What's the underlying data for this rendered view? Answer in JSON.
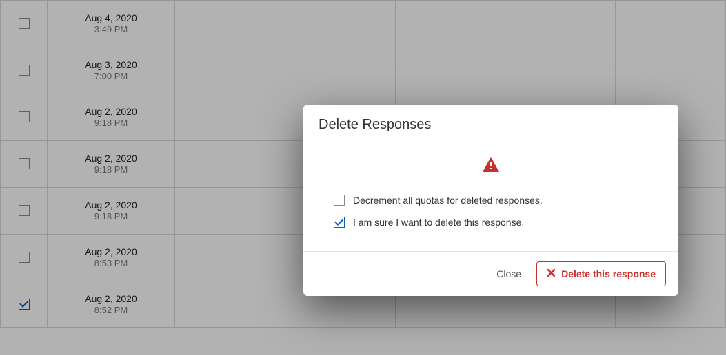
{
  "table": {
    "rows": [
      {
        "checked": false,
        "date": "Aug 4, 2020",
        "time": "3:49 PM"
      },
      {
        "checked": false,
        "date": "Aug 3, 2020",
        "time": "7:00 PM"
      },
      {
        "checked": false,
        "date": "Aug 2, 2020",
        "time": "9:18 PM"
      },
      {
        "checked": false,
        "date": "Aug 2, 2020",
        "time": "9:18 PM"
      },
      {
        "checked": false,
        "date": "Aug 2, 2020",
        "time": "9:18 PM"
      },
      {
        "checked": false,
        "date": "Aug 2, 2020",
        "time": "8:53 PM"
      },
      {
        "checked": true,
        "date": "Aug 2, 2020",
        "time": "8:52 PM"
      }
    ]
  },
  "modal": {
    "title": "Delete Responses",
    "options": [
      {
        "label": "Decrement all quotas for deleted responses.",
        "checked": false
      },
      {
        "label": "I am sure I want to delete this response.",
        "checked": true
      }
    ],
    "close_label": "Close",
    "delete_label": "Delete this response"
  },
  "colors": {
    "danger": "#c9302c",
    "accent": "#0a5cc7"
  }
}
